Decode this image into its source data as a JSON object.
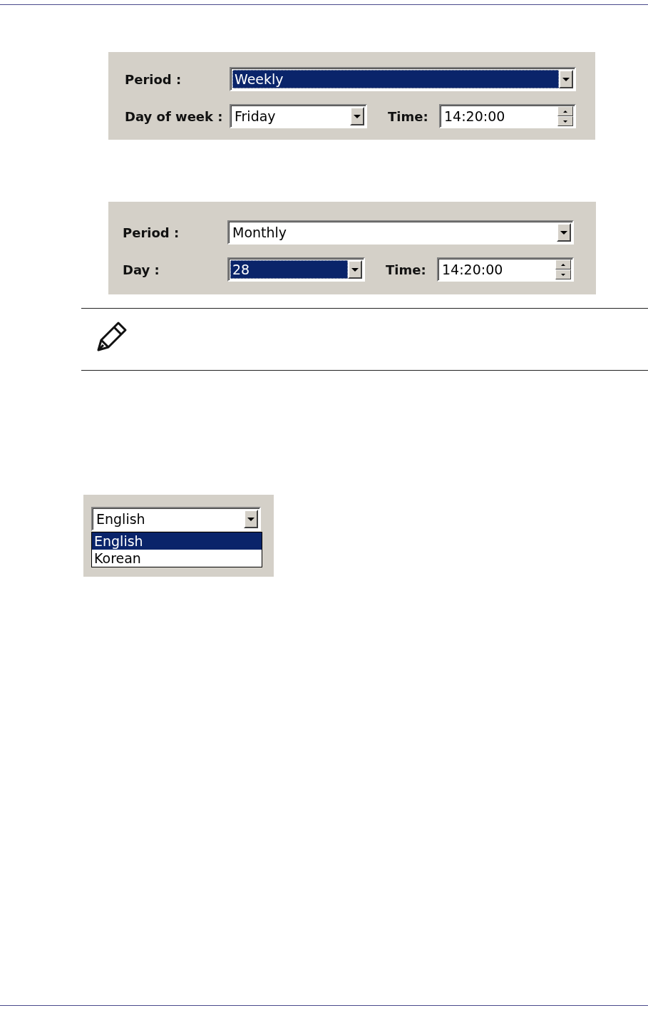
{
  "schedule_panels": [
    {
      "kind": "weekly",
      "period": {
        "label": "Period :",
        "value": "Weekly",
        "selected": true
      },
      "day": {
        "label": "Day of week :",
        "value": "Friday",
        "selected": false
      },
      "time": {
        "label": "Time:",
        "value": "14:20:00"
      }
    },
    {
      "kind": "monthly",
      "period": {
        "label": "Period :",
        "value": "Monthly",
        "selected": false
      },
      "day": {
        "label": "Day :",
        "value": "28",
        "selected": true
      },
      "time": {
        "label": "Time:",
        "value": "14:20:00"
      }
    }
  ],
  "language_dropdown": {
    "value": "English",
    "options": [
      {
        "label": "English",
        "selected": true
      },
      {
        "label": "Korean",
        "selected": false
      }
    ]
  }
}
